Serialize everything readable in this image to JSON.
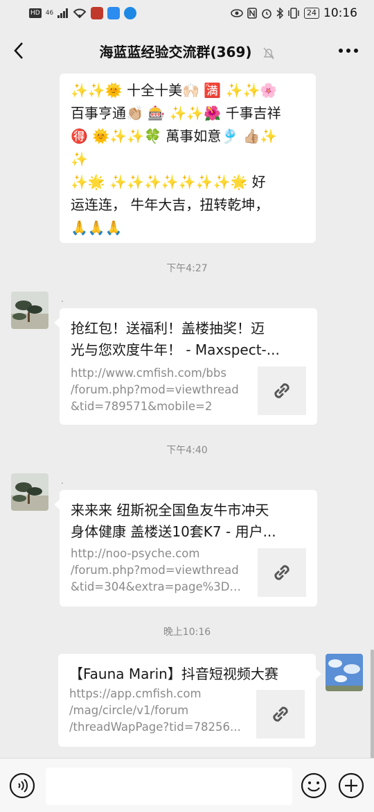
{
  "status_bar": {
    "left_badges": [
      "HD",
      "46"
    ],
    "battery": "24",
    "time": "10:16"
  },
  "header": {
    "title": "海蓝蓝经验交流群(369)",
    "back_icon": "chevron-left-icon",
    "mute_icon": "bell-muted-icon",
    "more_icon": "more-horizontal-icon"
  },
  "messages": {
    "text_lines": [
      "✨✨🌞 十全十美🙌🏻 🈵 ✨✨🌸",
      "百事亨通👏🏼 🎰 ✨✨🌺 千事吉祥",
      "🉐 🌞✨✨🍀 萬事如意🎐 👍🏼✨",
      "✨",
      "✨🌟 ✨✨✨✨✨✨✨🌟 好",
      "运连连， 牛年大吉，扭转乾坤，",
      "🙏🙏🙏"
    ],
    "timestamp_1": "下午4:27",
    "nickname_1": ".",
    "link_1": {
      "title_lines": [
        "抢红包！送福利！盖楼抽奖！迈",
        "光与您欢度牛年！ - Maxspect-..."
      ],
      "url_lines": [
        "http://www.cmfish.com/bbs",
        "/forum.php?mod=viewthread",
        "&tid=789571&mobile=2"
      ]
    },
    "timestamp_2": "下午4:40",
    "nickname_2": ".",
    "link_2": {
      "title_lines": [
        "来来来 纽斯祝全国鱼友牛市冲天",
        "身体健康 盖楼送10套K7 - 用户..."
      ],
      "url_lines": [
        "http://noo-psyche.com",
        "/forum.php?mod=viewthread",
        "&tid=304&extra=page%3D1..."
      ]
    },
    "timestamp_3": "晚上10:16",
    "link_3": {
      "title_lines": [
        "【Fauna Marin】抖音短视频大赛"
      ],
      "url_lines": [
        "https://app.cmfish.com",
        "/mag/circle/v1/forum",
        "/threadWapPage?tid=78256..."
      ]
    }
  },
  "input_bar": {
    "voice_icon": "voice-icon",
    "input_value": "",
    "emoji_icon": "emoji-icon",
    "plus_icon": "plus-circle-icon"
  }
}
